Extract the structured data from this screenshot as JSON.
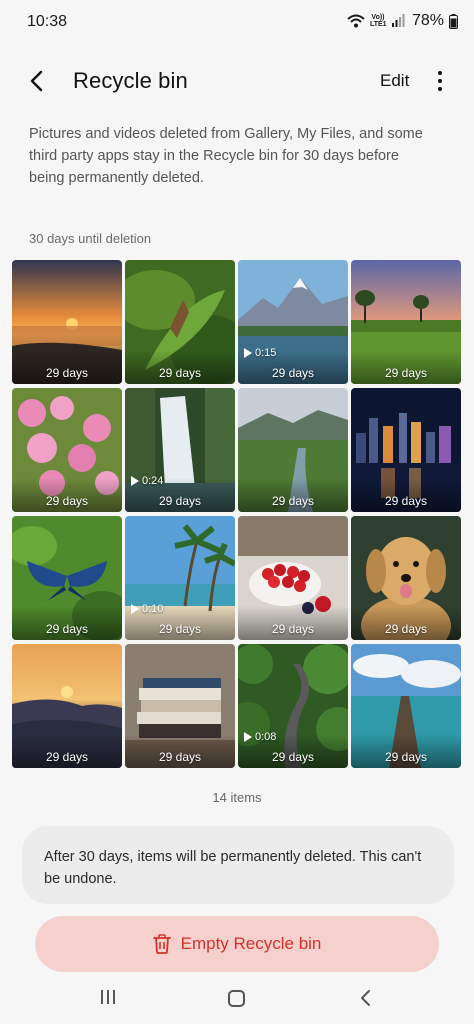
{
  "status": {
    "time": "10:38",
    "network_label": "Vo)) LTE1",
    "battery": "78%"
  },
  "header": {
    "title": "Recycle bin",
    "edit_label": "Edit"
  },
  "description": "Pictures and videos deleted from Gallery, My Files, and some third party apps stay in the Recycle bin for 30 days before being permanently deleted.",
  "section_label": "30 days until deletion",
  "items": [
    {
      "days": "29 days",
      "duration": "",
      "scene": "sunset-beach"
    },
    {
      "days": "29 days",
      "duration": "",
      "scene": "butterfly-leaf"
    },
    {
      "days": "29 days",
      "duration": "0:15",
      "scene": "mountain-lake"
    },
    {
      "days": "29 days",
      "duration": "",
      "scene": "tea-field"
    },
    {
      "days": "29 days",
      "duration": "",
      "scene": "pink-flowers"
    },
    {
      "days": "29 days",
      "duration": "0:24",
      "scene": "waterfall"
    },
    {
      "days": "29 days",
      "duration": "",
      "scene": "valley-river"
    },
    {
      "days": "29 days",
      "duration": "",
      "scene": "night-city"
    },
    {
      "days": "29 days",
      "duration": "",
      "scene": "blue-butterfly"
    },
    {
      "days": "29 days",
      "duration": "0:10",
      "scene": "palm-beach"
    },
    {
      "days": "29 days",
      "duration": "",
      "scene": "berries-bowl"
    },
    {
      "days": "29 days",
      "duration": "",
      "scene": "golden-retriever"
    },
    {
      "days": "29 days",
      "duration": "",
      "scene": "mountain-sunset"
    },
    {
      "days": "29 days",
      "duration": "",
      "scene": "book-stack"
    },
    {
      "days": "29 days",
      "duration": "0:08",
      "scene": "forest-road"
    },
    {
      "days": "29 days",
      "duration": "",
      "scene": "pier-sea"
    }
  ],
  "items_count": "14 items",
  "notice": "After 30 days, items will be permanently deleted. This can't be undone.",
  "empty_button_label": "Empty Recycle bin",
  "colors": {
    "background": "#f6f6f6",
    "danger_text": "#d2322b",
    "danger_bg": "#f6d0cd"
  }
}
